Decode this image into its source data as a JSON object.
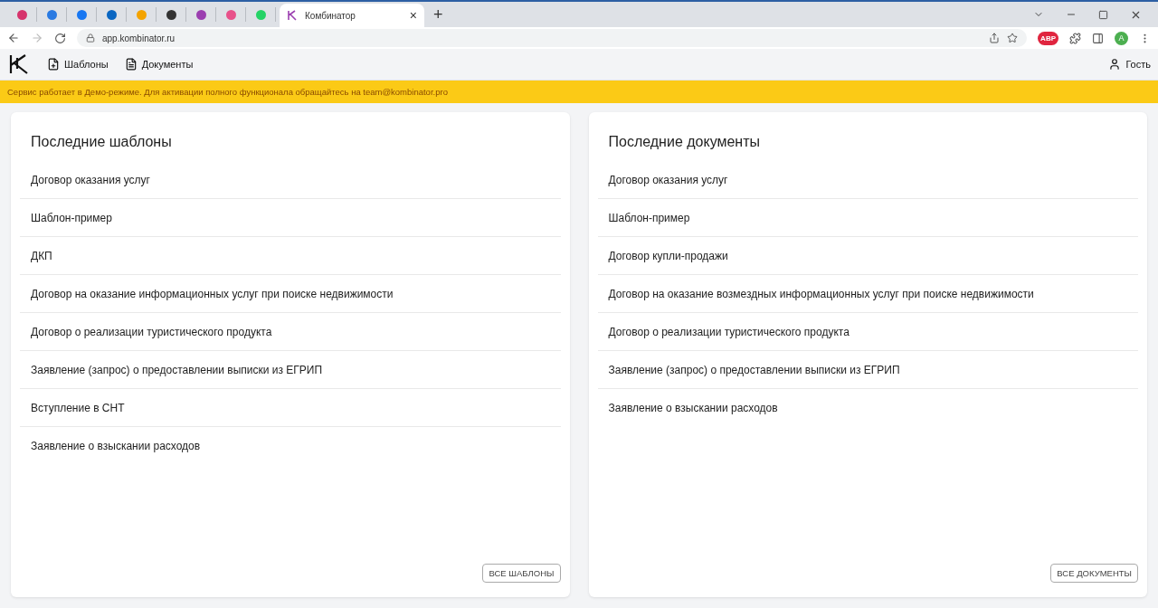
{
  "browser": {
    "active_tab": {
      "title": "Комбинатор",
      "close": "×"
    },
    "new_tab": "+",
    "url": "app.kombinator.ru",
    "adblock": "ABP",
    "profile": "A"
  },
  "nav": {
    "items": [
      {
        "label": "Шаблоны",
        "kind": "template"
      },
      {
        "label": "Документы",
        "kind": "document"
      }
    ],
    "user": "Гость"
  },
  "banner": "Сервис работает в Демо-режиме. Для активации полного функционала обращайтесь на team@kombinator.pro",
  "panels": [
    {
      "title": "Последние шаблоны",
      "items": [
        "Договор оказания услуг",
        "Шаблон-пример",
        "ДКП",
        "Договор на оказание информационных услуг при поиске недвижимости",
        "Договор о реализации туристического продукта",
        "Заявление (запрос) о предоставлении выписки из ЕГРИП",
        "Вступление в СНТ",
        "Заявление о взыскании расходов"
      ],
      "button": "ВСЕ ШАБЛОНЫ"
    },
    {
      "title": "Последние документы",
      "items": [
        "Договор оказания услуг",
        "Шаблон-пример",
        "Договор купли-продажи",
        "Договор на оказание возмездных информационных услуг при поиске недвижимости",
        "Договор о реализации туристического продукта",
        "Заявление (запрос) о предоставлении выписки из ЕГРИП",
        "Заявление о взыскании расходов"
      ],
      "button": "ВСЕ ДОКУМЕНТЫ"
    }
  ]
}
